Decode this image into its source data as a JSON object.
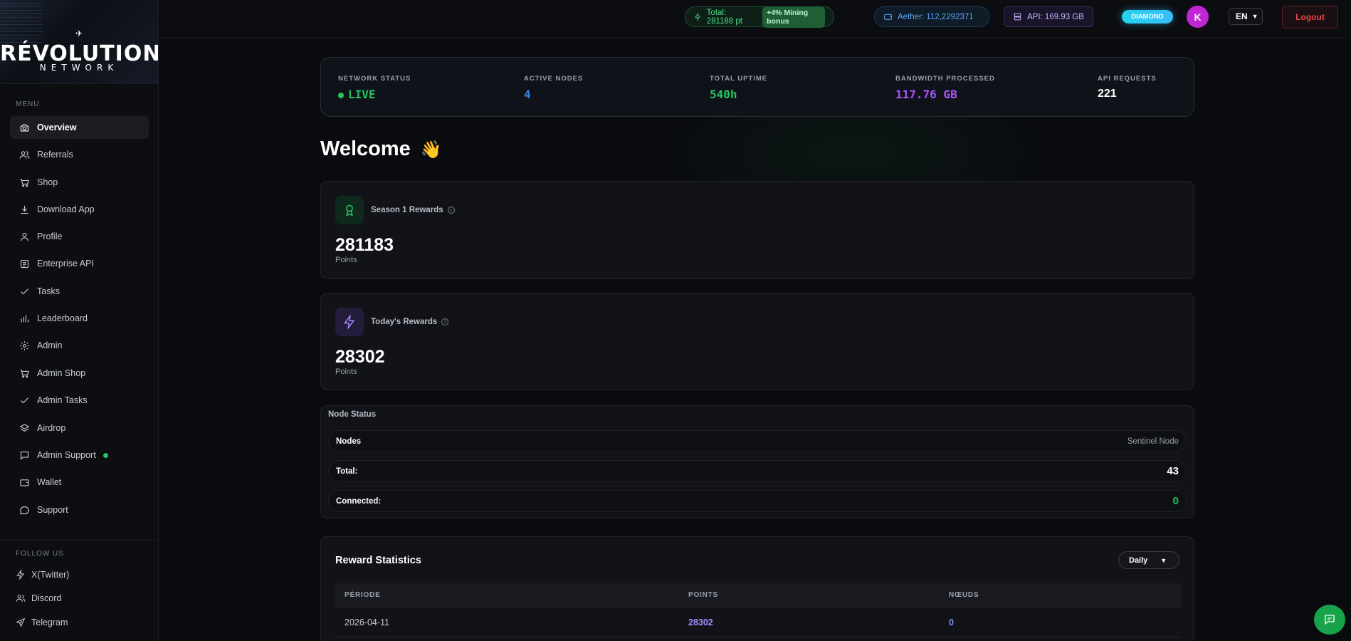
{
  "brand": {
    "name_line1": "RÉVOLUTION",
    "name_line2": "NETWORK"
  },
  "sidebar": {
    "menu_label": "MENU",
    "items": [
      {
        "label": "Overview",
        "icon": "camera-icon"
      },
      {
        "label": "Referrals",
        "icon": "users-icon"
      },
      {
        "label": "Shop",
        "icon": "cart-icon"
      },
      {
        "label": "Download App",
        "icon": "download-icon"
      },
      {
        "label": "Profile",
        "icon": "user-icon"
      },
      {
        "label": "Enterprise API",
        "icon": "document-icon"
      },
      {
        "label": "Tasks",
        "icon": "check-icon"
      },
      {
        "label": "Leaderboard",
        "icon": "bar-chart-icon"
      },
      {
        "label": "Admin",
        "icon": "gear-icon"
      },
      {
        "label": "Admin Shop",
        "icon": "cart-icon"
      },
      {
        "label": "Admin Tasks",
        "icon": "check-icon"
      },
      {
        "label": "Airdrop",
        "icon": "layers-icon"
      },
      {
        "label": "Admin Support",
        "icon": "message-icon"
      },
      {
        "label": "Wallet",
        "icon": "wallet-icon"
      },
      {
        "label": "Support",
        "icon": "chat-icon"
      }
    ],
    "follow_label": "FOLLOW US",
    "follow": [
      {
        "label": "X(Twitter)",
        "icon": "bolt-icon"
      },
      {
        "label": "Discord",
        "icon": "users-icon"
      },
      {
        "label": "Telegram",
        "icon": "send-icon"
      }
    ]
  },
  "topbar": {
    "total": "Total: 281188 pt",
    "bonus": "+4% Mining bonus",
    "aether": "Aether: 112,2292371",
    "api": "API: 169.93 GB",
    "tier": "DIAMOND",
    "avatar_initial": "K",
    "language": "EN",
    "logout": "Logout"
  },
  "network": {
    "stats": [
      {
        "label": "NETWORK STATUS",
        "value": "LIVE",
        "color": "#22c55e"
      },
      {
        "label": "ACTIVE NODES",
        "value": "4",
        "color": "#3b82f6"
      },
      {
        "label": "TOTAL UPTIME",
        "value": "540h",
        "color": "#22c55e"
      },
      {
        "label": "BANDWIDTH PROCESSED",
        "value": "117.76 GB",
        "color": "#a855f7"
      },
      {
        "label": "API REQUESTS",
        "value": "221",
        "color": "#ffffff"
      }
    ]
  },
  "welcome": {
    "title": "Welcome",
    "emoji": "👋"
  },
  "season": {
    "title": "Season 1 Rewards",
    "value": "281183",
    "unit": "Points"
  },
  "today": {
    "title": "Today's Rewards",
    "value": "28302",
    "unit": "Points"
  },
  "node_status": {
    "title": "Node Status",
    "header_left": "Nodes",
    "header_right": "Sentinel Node",
    "total_label": "Total:",
    "total_value": "43",
    "connected_label": "Connected:",
    "connected_value": "0"
  },
  "reward_stats": {
    "title": "Reward Statistics",
    "period_select": "Daily",
    "columns": [
      "PÉRIODE",
      "POINTS",
      "NŒUDS"
    ],
    "rows": [
      {
        "period": "2026-04-11",
        "points": "28302",
        "nodes": "0"
      }
    ]
  }
}
